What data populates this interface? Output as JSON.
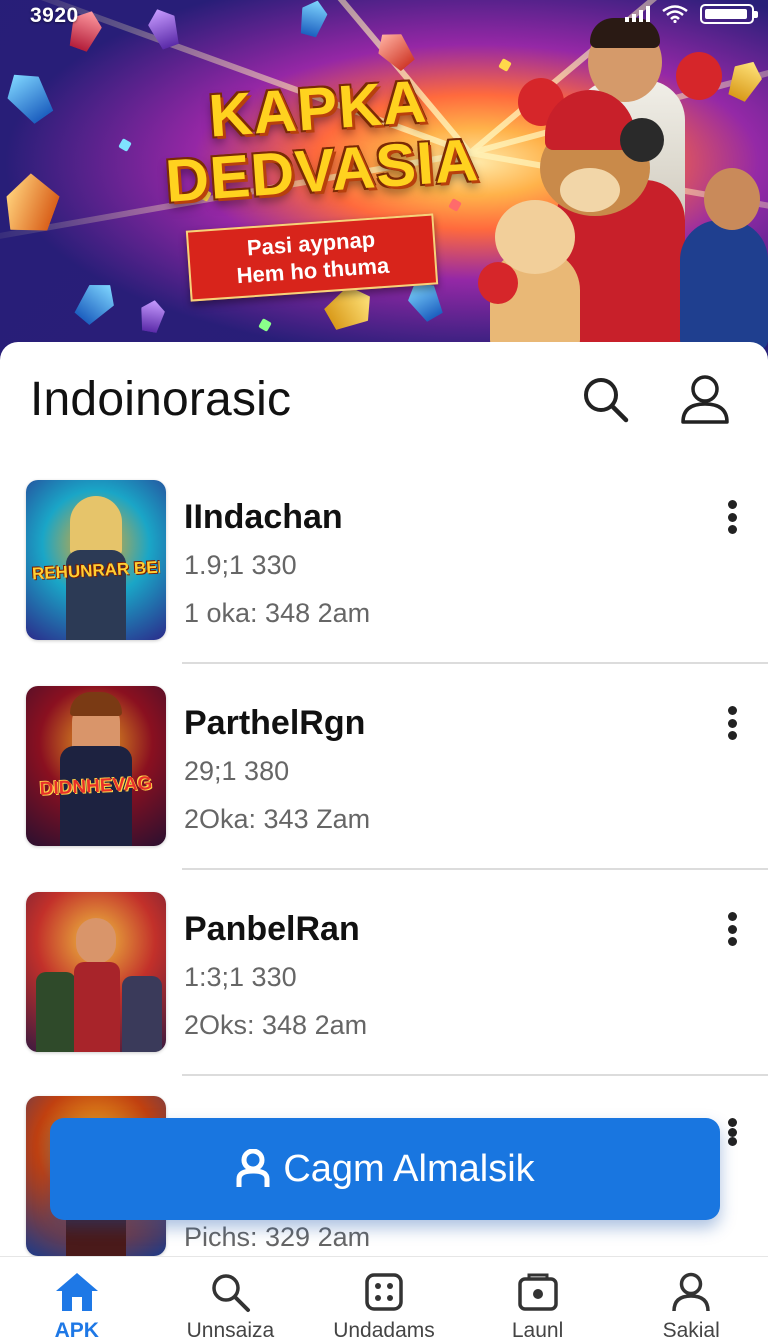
{
  "status_bar": {
    "time": "3920"
  },
  "hero": {
    "title_line1": "KAPKA",
    "title_line2": "DEDVASIA",
    "tagline_line1": "Pasi aypnap",
    "tagline_line2": "Hem ho thuma"
  },
  "header": {
    "title": "Indoinorasic",
    "search_icon": "search-icon",
    "profile_icon": "person-icon"
  },
  "list": {
    "items": [
      {
        "name": "IIndachan",
        "sub1": "1.9;1 330",
        "sub2": "1 oka: 348 2am",
        "thumb_text": "REHUNRAR BELIC",
        "thumb_colors": [
          "#2b2a8a",
          "#1aa6c7",
          "#f4a81f"
        ]
      },
      {
        "name": "ParthelRgn",
        "sub1": "29;1 380",
        "sub2": "2Oka: 343 Zam",
        "thumb_text": "DIDNHEVAG",
        "thumb_colors": [
          "#2a1030",
          "#8a1020",
          "#e8a020"
        ]
      },
      {
        "name": "PanbelRan",
        "sub1": "1:3;1 330",
        "sub2": "2Oks: 348 2am",
        "thumb_text": "",
        "thumb_colors": [
          "#3a1a40",
          "#c2302a",
          "#f0c040"
        ]
      },
      {
        "name": "",
        "sub1": "",
        "sub2": "Pichs: 329 2am",
        "thumb_text": "",
        "thumb_colors": [
          "#1a3a8a",
          "#c04010",
          "#f0b020"
        ]
      }
    ]
  },
  "cta": {
    "label": "Cagm Almalsik",
    "icon": "person-icon"
  },
  "bottom_nav": {
    "items": [
      {
        "label": "APK",
        "icon": "home-icon",
        "active": true
      },
      {
        "label": "Unnsaiza",
        "icon": "search-icon",
        "active": false
      },
      {
        "label": "Undadams",
        "icon": "dice-grid-icon",
        "active": false
      },
      {
        "label": "Launl",
        "icon": "box-icon",
        "active": false
      },
      {
        "label": "Sakial",
        "icon": "person-icon",
        "active": false
      }
    ]
  },
  "colors": {
    "accent": "#1976e0",
    "active_nav": "#1e78e6",
    "hero_title": "#ffd21f",
    "hero_tag_bg": "#d8241b"
  }
}
